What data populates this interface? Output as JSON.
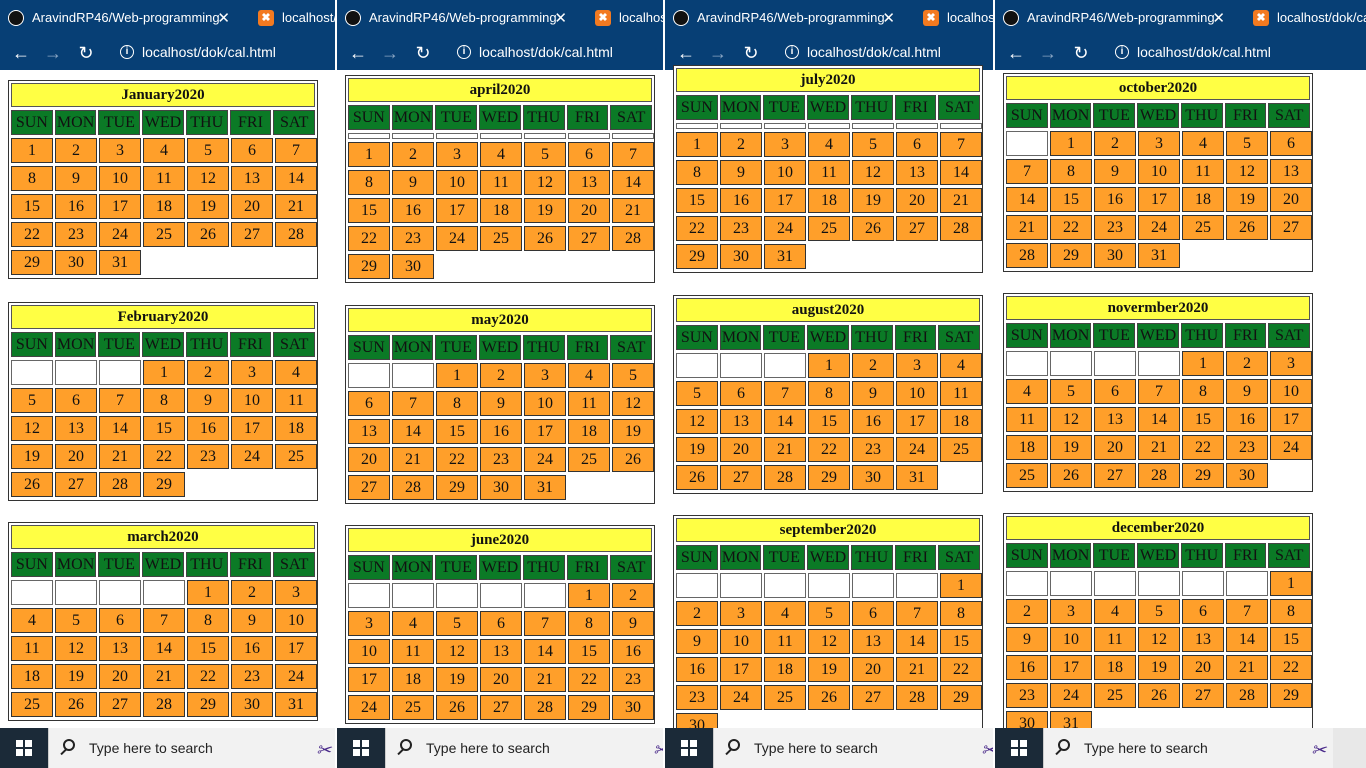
{
  "browser": {
    "tab1_title": "AravindRP46/Web-programming",
    "tab2_title": "localhost/dok/cal.html",
    "url": "localhost/dok/cal.html",
    "close_glyph": "✕"
  },
  "taskbar": {
    "search_placeholder": "Type here to search"
  },
  "weekdays": [
    "SUN",
    "MON",
    "TUE",
    "WED",
    "THU",
    "FRI",
    "SAT"
  ],
  "colors": {
    "title_bg": "#ffff44",
    "header_bg": "#0b7a26",
    "day_bg": "#ff9f2a",
    "browser_bg": "#073f75"
  },
  "panes": [
    {
      "months": [
        {
          "title": "January2020",
          "lead_empty": 0,
          "lead_style": "none",
          "days": 31
        },
        {
          "title": "February2020",
          "lead_empty": 3,
          "lead_style": "square",
          "days": 29
        },
        {
          "title": "march2020",
          "lead_empty": 4,
          "lead_style": "square",
          "days": 31
        }
      ]
    },
    {
      "months": [
        {
          "title": "april2020",
          "lead_empty": 7,
          "lead_style": "thin",
          "days": 30
        },
        {
          "title": "may2020",
          "lead_empty": 2,
          "lead_style": "square",
          "days": 31
        },
        {
          "title": "june2020",
          "lead_empty": 5,
          "lead_style": "square",
          "days": 30
        }
      ]
    },
    {
      "months": [
        {
          "title": "july2020",
          "lead_empty": 7,
          "lead_style": "thin",
          "days": 31
        },
        {
          "title": "august2020",
          "lead_empty": 3,
          "lead_style": "square",
          "days": 31
        },
        {
          "title": "september2020",
          "lead_empty": 6,
          "lead_style": "square",
          "days": 30
        }
      ]
    },
    {
      "months": [
        {
          "title": "october2020",
          "lead_empty": 1,
          "lead_style": "square",
          "days": 31
        },
        {
          "title": "novermber2020",
          "lead_empty": 4,
          "lead_style": "square",
          "days": 30
        },
        {
          "title": "december2020",
          "lead_empty": 6,
          "lead_style": "square",
          "days": 31
        }
      ]
    }
  ]
}
